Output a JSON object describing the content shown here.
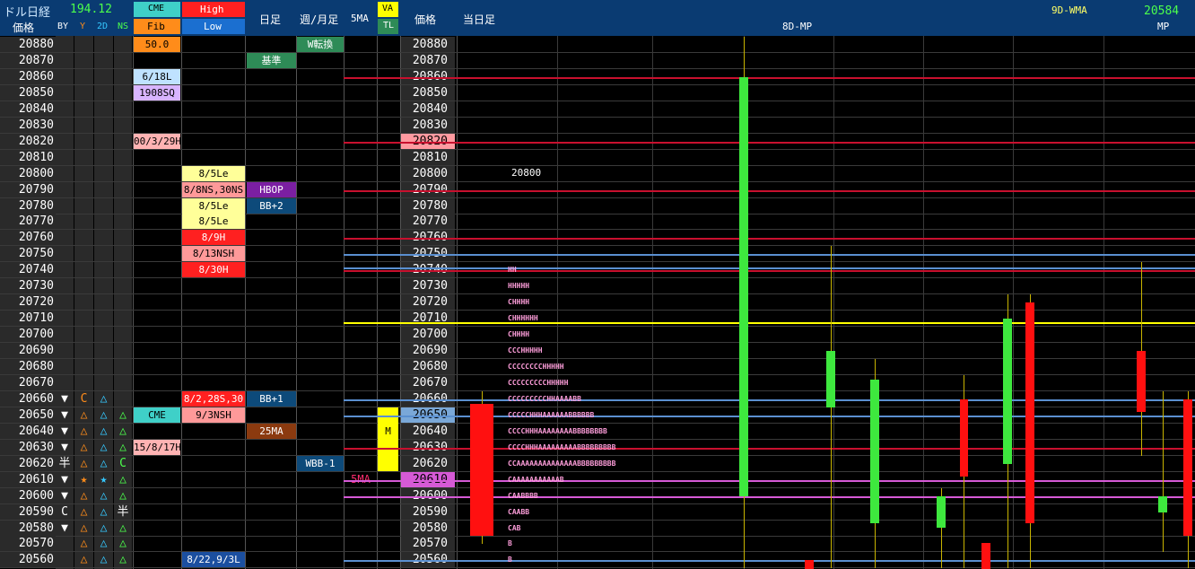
{
  "header": {
    "title": "ドル日経",
    "price_value": "194.12",
    "price_label": "価格",
    "cols": [
      "BY",
      "Y",
      "2D",
      "NS"
    ],
    "cme_label": "CME",
    "fib_label": "Fib",
    "high_label": "High",
    "low_label": "Low",
    "daily_label": "日足",
    "weekly_label": "週/月足",
    "ma5_label": "5MA",
    "va_label": "VA",
    "tl_label": "TL",
    "price_label2": "価格",
    "today_label": "当日足",
    "mp_title": "8D-MP",
    "wma_label": "9D-WMA",
    "wma_value": "20584",
    "mp_label": "MP"
  },
  "prices": [
    "20880",
    "20870",
    "20860",
    "20850",
    "20840",
    "20830",
    "20820",
    "20810",
    "20800",
    "20790",
    "20780",
    "20770",
    "20760",
    "20750",
    "20740",
    "20730",
    "20720",
    "20710",
    "20700",
    "20690",
    "20680",
    "20670",
    "20660",
    "20650",
    "20640",
    "20630",
    "20620",
    "20610",
    "20600",
    "20590",
    "20580",
    "20570",
    "20560"
  ],
  "symbols": {
    "by": [
      "",
      "",
      "",
      "",
      "",
      "",
      "",
      "",
      "",
      "",
      "",
      "",
      "",
      "",
      "",
      "",
      "",
      "",
      "",
      "",
      "",
      "",
      "▼",
      "▼",
      "▼",
      "▼",
      "半",
      "▼",
      "▼",
      "C",
      "▼",
      "",
      ""
    ],
    "y": [
      "",
      "",
      "",
      "",
      "",
      "",
      "",
      "",
      "",
      "",
      "",
      "",
      "",
      "",
      "",
      "",
      "",
      "",
      "",
      "",
      "",
      "",
      "C",
      "△",
      "△",
      "△",
      "△",
      "★",
      "△",
      "△",
      "△",
      "△",
      "△"
    ],
    "d2": [
      "",
      "",
      "",
      "",
      "",
      "",
      "",
      "",
      "",
      "",
      "",
      "",
      "",
      "",
      "",
      "",
      "",
      "",
      "",
      "",
      "",
      "",
      "△",
      "△",
      "△",
      "△",
      "△",
      "★",
      "△",
      "△",
      "△",
      "△",
      "△"
    ],
    "ns": [
      "",
      "",
      "",
      "",
      "",
      "",
      "",
      "",
      "",
      "",
      "",
      "",
      "",
      "",
      "",
      "",
      "",
      "",
      "",
      "",
      "",
      "",
      "",
      "△",
      "△",
      "△",
      "C",
      "△",
      "△",
      "半",
      "△",
      "△",
      "△"
    ]
  },
  "cme_fib": [
    {
      "row": 0,
      "text": "50.0",
      "bg": "#ff8c1a",
      "fg": "#000000"
    },
    {
      "row": 2,
      "text": "6/18L",
      "bg": "#bfe2ff",
      "fg": "#000000"
    },
    {
      "row": 3,
      "text": "1908SQ",
      "bg": "#d8b4ff",
      "fg": "#000000"
    },
    {
      "row": 6,
      "text": "00/3/29H",
      "bg": "#ffb3b3",
      "fg": "#000000"
    },
    {
      "row": 23,
      "text": "CME",
      "bg": "#3fd0c8",
      "fg": "#000000"
    },
    {
      "row": 25,
      "text": "15/8/17H",
      "bg": "#ffb3b3",
      "fg": "#000000"
    }
  ],
  "high_low": [
    {
      "row": 8,
      "text": "8/5Le",
      "bg": "#ffff99",
      "fg": "#000000"
    },
    {
      "row": 9,
      "text": "8/8NS,30NS",
      "bg": "#ff9999",
      "fg": "#000000"
    },
    {
      "row": 10,
      "text": "8/5Le",
      "bg": "#ffff99",
      "fg": "#000000"
    },
    {
      "row": 11,
      "text": "8/5Le",
      "bg": "#ffff99",
      "fg": "#000000"
    },
    {
      "row": 12,
      "text": "8/9H",
      "bg": "#ff2020",
      "fg": "#ffffff"
    },
    {
      "row": 13,
      "text": "8/13NSH",
      "bg": "#ff9999",
      "fg": "#000000"
    },
    {
      "row": 14,
      "text": "8/30H",
      "bg": "#ff2020",
      "fg": "#ffffff"
    },
    {
      "row": 22,
      "text": "8/2,28S,30",
      "bg": "#ff2020",
      "fg": "#ffffff"
    },
    {
      "row": 23,
      "text": "9/3NSH",
      "bg": "#ff9999",
      "fg": "#000000"
    },
    {
      "row": 32,
      "text": "8/22,9/3L",
      "bg": "#1b4fa0",
      "fg": "#ffffff"
    }
  ],
  "daily": [
    {
      "row": 1,
      "text": "基準",
      "bg": "#2e8b57",
      "fg": "#ffffff"
    },
    {
      "row": 9,
      "text": "HBOP",
      "bg": "#7b1fa2",
      "fg": "#ffffff"
    },
    {
      "row": 10,
      "text": "BB+2",
      "bg": "#0d4a7a",
      "fg": "#ffffff"
    },
    {
      "row": 22,
      "text": "BB+1",
      "bg": "#0d4a7a",
      "fg": "#ffffff"
    },
    {
      "row": 24,
      "text": "25MA",
      "bg": "#8b3a0f",
      "fg": "#ffffff"
    }
  ],
  "weekly": [
    {
      "row": 0,
      "text": "W転換",
      "bg": "#2e8b57",
      "fg": "#ffffff"
    },
    {
      "row": 26,
      "text": "WBB-1",
      "bg": "#0d4a7a",
      "fg": "#ffffff"
    }
  ],
  "ma5": {
    "row": 27,
    "text": "5MA",
    "color": "#ff2d6f"
  },
  "va": {
    "rows": [
      23,
      24,
      25,
      26
    ],
    "text": "M",
    "row_text": 24,
    "color": "#ffff00"
  },
  "price_highlights": [
    {
      "row": 6,
      "bg": "#ff9aa0"
    },
    {
      "row": 23,
      "bg": "#7aa8d8"
    },
    {
      "row": 27,
      "bg": "#d65ad6"
    }
  ],
  "annotation": "20800",
  "levels": [
    {
      "row": 2.5,
      "color": "#c8102e"
    },
    {
      "row": 6.5,
      "color": "#c8102e"
    },
    {
      "row": 9.5,
      "color": "#c8102e"
    },
    {
      "row": 12.5,
      "color": "#c8102e"
    },
    {
      "row": 13.5,
      "color": "#5a8fd0"
    },
    {
      "row": 14.3,
      "color": "#5a8fd0"
    },
    {
      "row": 14.5,
      "color": "#c8102e"
    },
    {
      "row": 17.7,
      "color": "#ffff00"
    },
    {
      "row": 22.5,
      "color": "#5a8fd0"
    },
    {
      "row": 23.5,
      "color": "#5a8fd0"
    },
    {
      "row": 25.5,
      "color": "#c8102e"
    },
    {
      "row": 27.5,
      "color": "#d65ad6"
    },
    {
      "row": 28.5,
      "color": "#d65ad6"
    },
    {
      "row": 32.5,
      "color": "#5a8fd0"
    }
  ],
  "profile": [
    "HH",
    "HHHHH",
    "CHHHH",
    "CHHHHHH",
    "CHHHH",
    "CCCHHHHH",
    "CCCCCCCCHHHHH",
    "CCCCCCCCCHHHHH",
    "CCCCCCCCCHHAAAABB",
    "CCCCCHHHAAAAAABBBBBB",
    "CCCCHHHAAAAAAAABBBBBBBB",
    "CCCCHHHAAAAAAAAABBBBBBBBB",
    "CCAAAAAAAAAAAAAABBBBBBBBB",
    "CAAAAAAAAAAAB",
    "CAABBBB",
    "CAABB",
    "CAB",
    "B",
    "B"
  ],
  "candles": [
    {
      "open": 20657,
      "close": 20575,
      "high": 20660,
      "low": 20575,
      "color": "red"
    },
    {
      "open": 20600,
      "close": 20860,
      "high": 20880,
      "low": 20560,
      "color": "green"
    },
    {
      "open": 20655,
      "close": 20690,
      "high": 20750,
      "low": 20560,
      "color": "green"
    },
    {
      "open": 20583,
      "close": 20672,
      "high": 20680,
      "low": 20560,
      "color": "green"
    },
    {
      "open": 20580,
      "close": 20600,
      "high": 20600,
      "low": 20560,
      "color": "green"
    },
    {
      "open": 20660,
      "close": 20612,
      "high": 20670,
      "low": 20560,
      "color": "red"
    },
    {
      "open": 20620,
      "close": 20710,
      "high": 20720,
      "low": 20560,
      "color": "green"
    },
    {
      "open": 20720,
      "close": 20583,
      "high": 20720,
      "low": 20560,
      "color": "red"
    },
    {
      "open": 20690,
      "close": 20652,
      "high": 20740,
      "low": 20630,
      "color": "red"
    },
    {
      "open": 20590,
      "close": 20600,
      "high": 20660,
      "low": 20570,
      "color": "green"
    },
    {
      "open": 20660,
      "close": 20575,
      "high": 20660,
      "low": 20560,
      "color": "red"
    }
  ]
}
